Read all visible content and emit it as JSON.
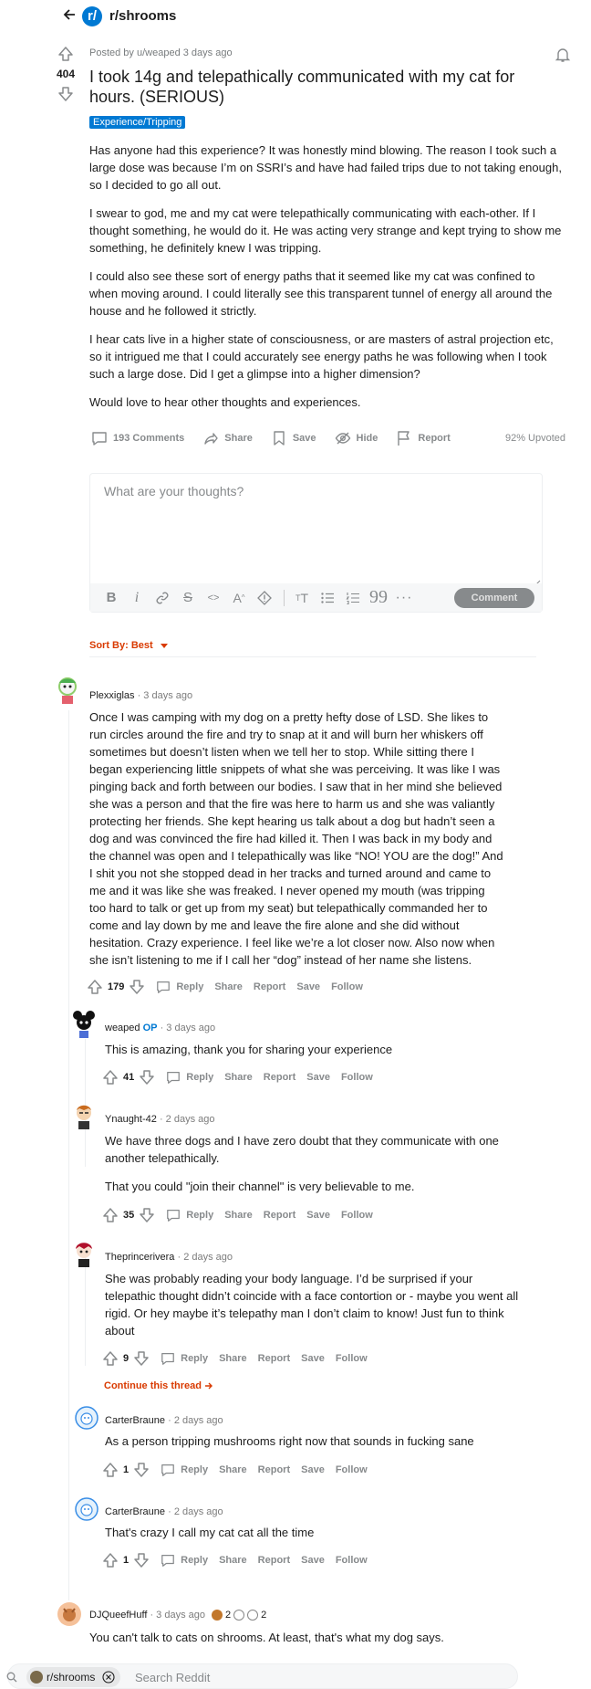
{
  "header": {
    "subreddit": "r/shrooms",
    "logo_letter": "r/"
  },
  "post": {
    "score": "404",
    "meta": "Posted by u/weaped 3 days ago",
    "title": "I took 14g and telepathically communicated with my cat for hours. (SERIOUS)",
    "flair": "Experience/Tripping",
    "paragraphs": [
      "Has anyone had this experience? It was honestly mind blowing. The reason I took such a large dose was because I’m on SSRI’s and have had failed trips due to not taking enough, so I decided to go all out.",
      "I swear to god, me and my cat were telepathically communicating with each-other. If I thought something, he would do it. He was acting very strange and kept trying to show me something, he definitely knew I was tripping.",
      "I could also see these sort of energy paths that it seemed like my cat was confined to when moving around. I could literally see this transparent tunnel of energy all around the house and he followed it strictly.",
      "I hear cats live in a higher state of consciousness, or are masters of astral projection etc, so it intrigued me that I could accurately see energy paths he was following when I took such a large dose. Did I get a glimpse into a higher dimension?",
      "Would love to hear other thoughts and experiences."
    ],
    "actions": {
      "comments": "193 Comments",
      "share": "Share",
      "save": "Save",
      "hide": "Hide",
      "report": "Report"
    },
    "upvoted": "92% Upvoted"
  },
  "composer": {
    "placeholder": "What are your thoughts?",
    "comment_button": "Comment"
  },
  "sort": {
    "label": "Sort By: Best"
  },
  "action_labels": {
    "reply": "Reply",
    "share": "Share",
    "report": "Report",
    "save": "Save",
    "follow": "Follow"
  },
  "comments": [
    {
      "author": "Plexxiglas",
      "time": " · 3 days ago",
      "score": "179",
      "text": [
        "Once I was camping with my dog on a pretty hefty dose of LSD. She likes to run circles around the fire and try to snap at it and will burn her whiskers off sometimes but doesn’t listen when we tell her to stop. While sitting there I began experiencing little snippets of what she was perceiving. It was like I was pinging back and forth between our bodies. I saw that in her mind she believed she was a person and that the fire was here to harm us and she was valiantly protecting her friends. She kept hearing us talk about a dog but hadn’t seen a dog and was convinced the fire had killed it. Then I was back in my body and the channel was open and I telepathically was like “NO! YOU are the dog!” And I shit you not she stopped dead in her tracks and turned around and came to me and it was like she was freaked. I never opened my mouth (was tripping too hard to talk or get up from my seat) but telepathically commanded her to come and lay down by me and leave the fire alone and she did without hesitation. Crazy experience. I feel like we’re a lot closer now. Also now when she isn’t listening to me if I call her “dog” instead of her name she listens."
      ]
    },
    {
      "author": "weaped",
      "op": "OP",
      "time": " · 3 days ago",
      "score": "41",
      "text": [
        "This is amazing, thank you for sharing your experience"
      ]
    },
    {
      "author": "Ynaught-42",
      "time": " · 2 days ago",
      "score": "35",
      "text": [
        "We have three dogs and I have zero doubt that they communicate with one another telepathically.",
        "That you could \"join their channel\" is very believable to me."
      ]
    },
    {
      "author": "Theprincerivera",
      "time": " · 2 days ago",
      "score": "9",
      "text": [
        "She was probably reading your body language. I’d be surprised if your telepathic thought didn’t coincide with a face contortion or - maybe you went all rigid. Or hey maybe it’s telepathy man I don’t claim to know! Just fun to think about"
      ]
    },
    {
      "author": "CarterBraune",
      "time": " · 2 days ago",
      "score": "1",
      "text": [
        "As a person tripping mushrooms right now that sounds in fucking sane"
      ]
    },
    {
      "author": "CarterBraune",
      "time": " · 2 days ago",
      "score": "1",
      "text": [
        "That's crazy I call my cat cat all the time"
      ]
    },
    {
      "author": "DJQueefHuff",
      "time": " · 3 days ago",
      "award1": "2",
      "award2": "2",
      "text": [
        "You can't talk to cats on shrooms. At least, that's what my dog says."
      ]
    }
  ],
  "continue_thread": "Continue this thread",
  "search": {
    "chip": "r/shrooms",
    "placeholder": "Search Reddit"
  }
}
